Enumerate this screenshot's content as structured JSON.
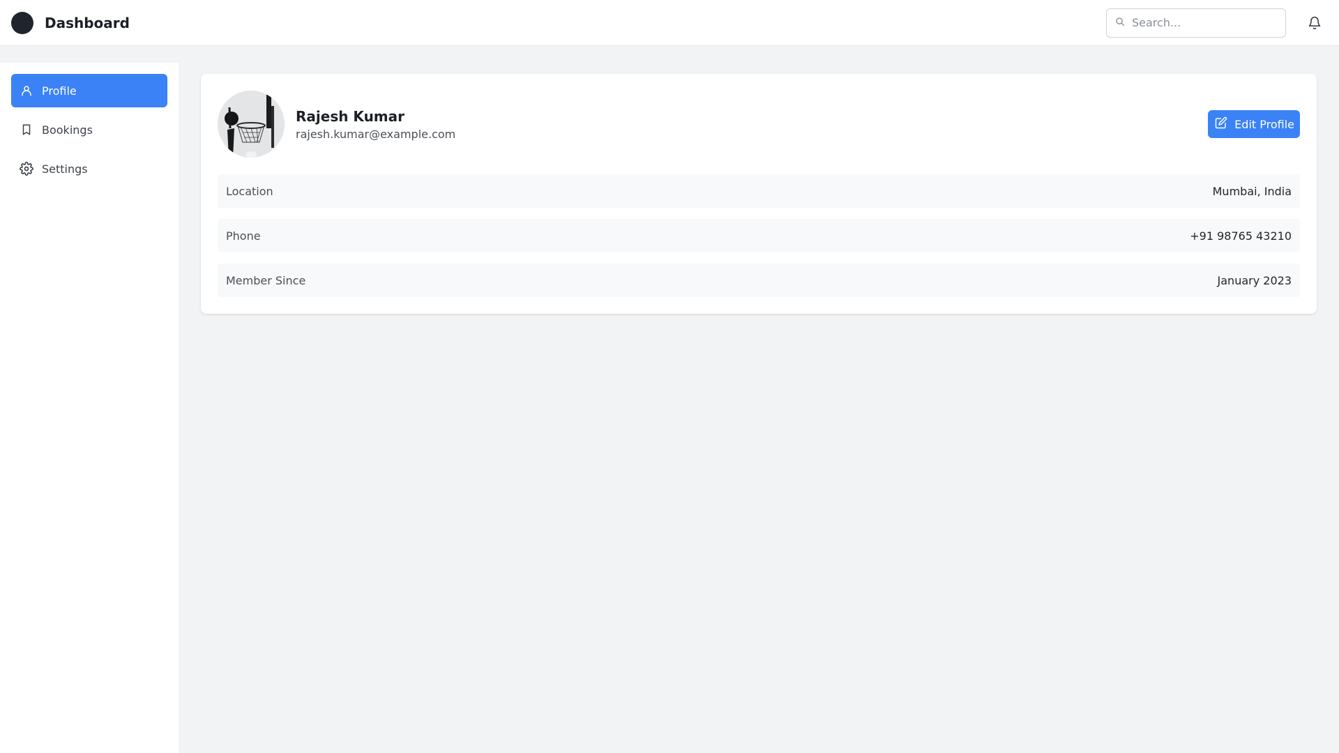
{
  "header": {
    "title": "Dashboard",
    "search_placeholder": "Search...",
    "search_value": ""
  },
  "sidebar": {
    "items": [
      {
        "label": "Profile",
        "icon": "user-icon",
        "active": true
      },
      {
        "label": "Bookings",
        "icon": "bookmark-icon",
        "active": false
      },
      {
        "label": "Settings",
        "icon": "gear-icon",
        "active": false
      }
    ]
  },
  "profile": {
    "name": "Rajesh Kumar",
    "email": "rajesh.kumar@example.com",
    "edit_label": "Edit Profile",
    "details": [
      {
        "label": "Location",
        "value": "Mumbai, India"
      },
      {
        "label": "Phone",
        "value": "+91 98765 43210"
      },
      {
        "label": "Member Since",
        "value": "January 2023"
      }
    ]
  },
  "colors": {
    "accent": "#3b82f6",
    "background": "#f2f3f5",
    "surface": "#ffffff",
    "row_background": "#f8f9fa"
  }
}
